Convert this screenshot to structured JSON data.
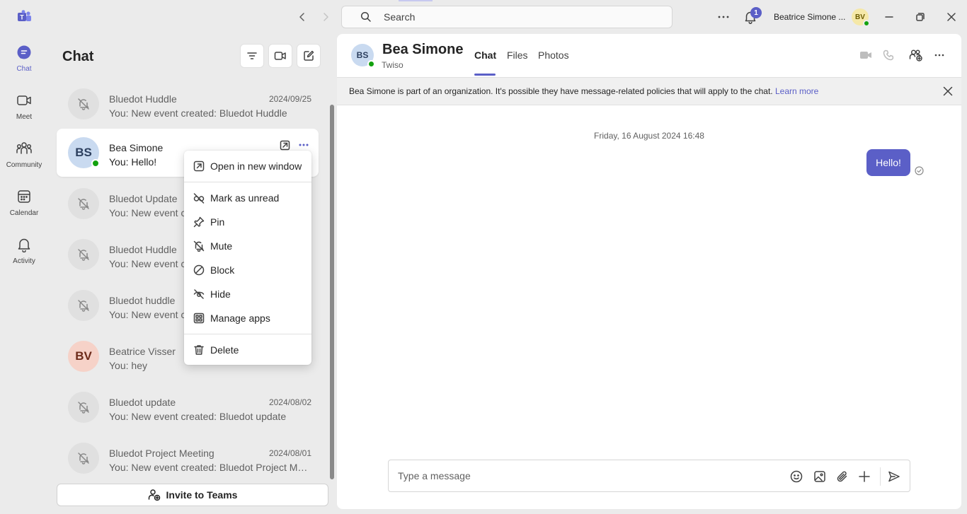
{
  "rail": {
    "items": [
      {
        "label": "Chat",
        "icon": "chat-icon",
        "active": true
      },
      {
        "label": "Meet",
        "icon": "video-icon"
      },
      {
        "label": "Community",
        "icon": "people-icon"
      },
      {
        "label": "Calendar",
        "icon": "calendar-icon"
      },
      {
        "label": "Activity",
        "icon": "bell-icon"
      }
    ]
  },
  "titlebar": {
    "search_placeholder": "Search",
    "notification_count": "1",
    "user_name": "Beatrice Simone ...",
    "user_initials": "BV"
  },
  "chat_list": {
    "title": "Chat",
    "items": [
      {
        "name": "Bluedot Huddle",
        "preview": "You: New event created: Bluedot Huddle",
        "date": "2024/09/25"
      },
      {
        "name": "Bea Simone",
        "preview": "You: Hello!",
        "initials": "BS",
        "selected": true
      },
      {
        "name": "Bluedot Update",
        "preview": "You: New event c"
      },
      {
        "name": "Bluedot Huddle",
        "preview": "You: New event c"
      },
      {
        "name": "Bluedot huddle",
        "preview": "You: New event c"
      },
      {
        "name": "Beatrice Visser",
        "preview": "You: hey",
        "initials": "BV"
      },
      {
        "name": "Bluedot update",
        "preview": "You: New event created: Bluedot update",
        "date": "2024/08/02"
      },
      {
        "name": "Bluedot Project Meeting",
        "preview": "You: New event created: Bluedot Project Me...",
        "date": "2024/08/01"
      }
    ],
    "invite_label": "Invite to Teams"
  },
  "context_menu": {
    "items": [
      {
        "label": "Open in new window",
        "icon": "open-window-icon"
      },
      {
        "label": "Mark as unread",
        "icon": "unread-icon"
      },
      {
        "label": "Pin",
        "icon": "pin-icon"
      },
      {
        "label": "Mute",
        "icon": "mute-icon"
      },
      {
        "label": "Block",
        "icon": "block-icon"
      },
      {
        "label": "Hide",
        "icon": "hide-icon"
      },
      {
        "label": "Manage apps",
        "icon": "apps-icon"
      },
      {
        "label": "Delete",
        "icon": "delete-icon"
      }
    ]
  },
  "conversation": {
    "contact_initials": "BS",
    "contact_name": "Bea Simone",
    "contact_org": "Twiso",
    "tabs": [
      "Chat",
      "Files",
      "Photos"
    ],
    "active_tab": "Chat",
    "banner_text": "Bea Simone is part of an organization. It's possible they have message-related policies that will apply to the chat.",
    "banner_link": "Learn more",
    "date_separator": "Friday, 16 August 2024 16:48",
    "messages": [
      {
        "text": "Hello!",
        "from": "me"
      }
    ],
    "composer_placeholder": "Type a message"
  },
  "colors": {
    "accent": "#5b5fc7",
    "presence_available": "#13a10e",
    "rail_background": "#ebebeb"
  }
}
